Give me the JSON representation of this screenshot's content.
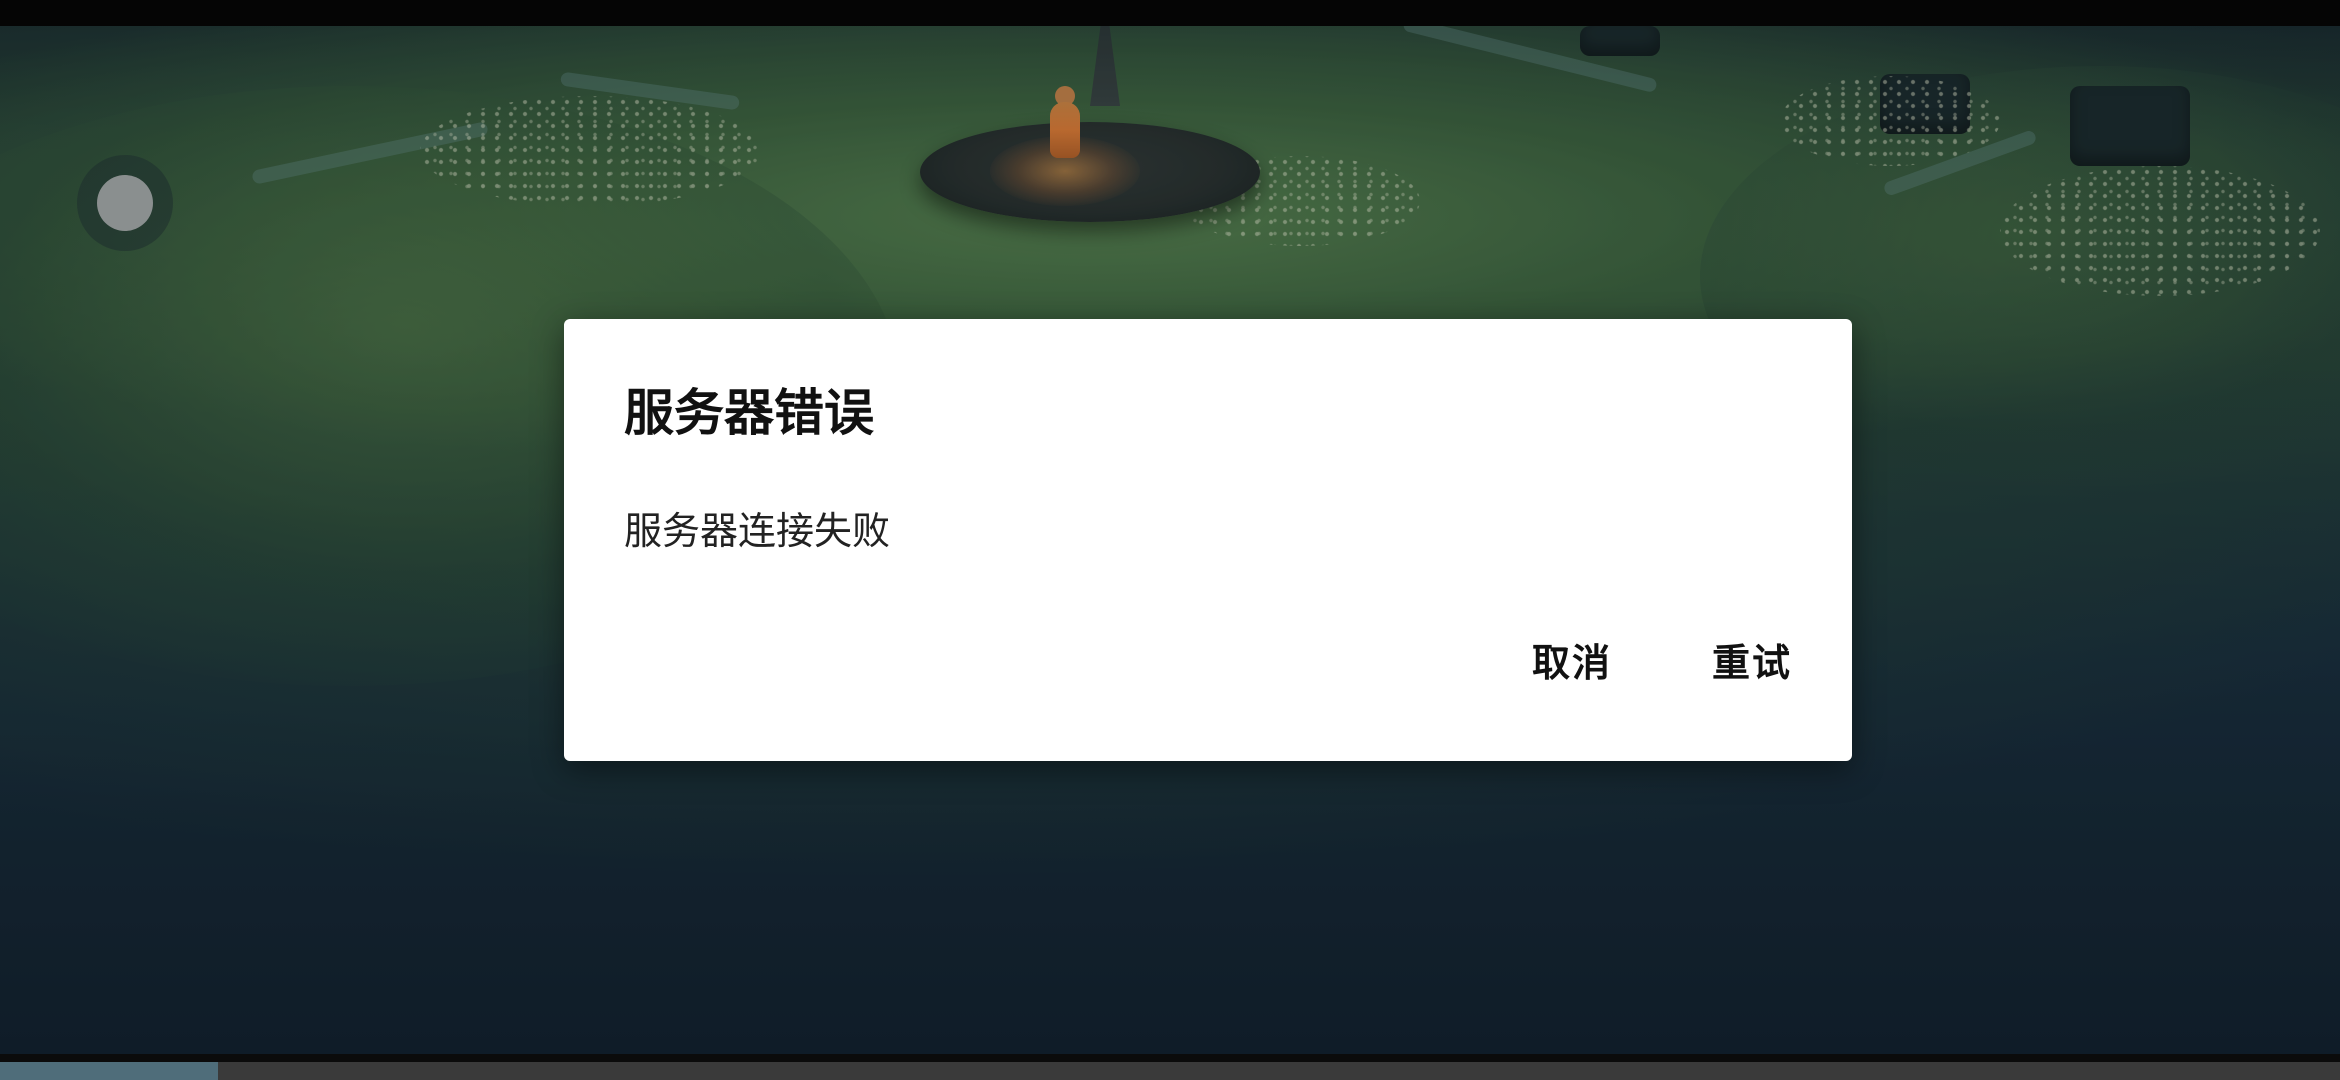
{
  "dialog": {
    "title": "服务器错误",
    "message": "服务器连接失败",
    "cancel_label": "取消",
    "retry_label": "重试"
  },
  "game": {
    "joystick_icon": "joystick-icon",
    "loading_progress": 0.093
  },
  "colors": {
    "dialog_background": "#ffffff",
    "scene_background": "#1a3040",
    "progress_fill": "#4f6d7a",
    "progress_track": "#3a3a3a"
  }
}
